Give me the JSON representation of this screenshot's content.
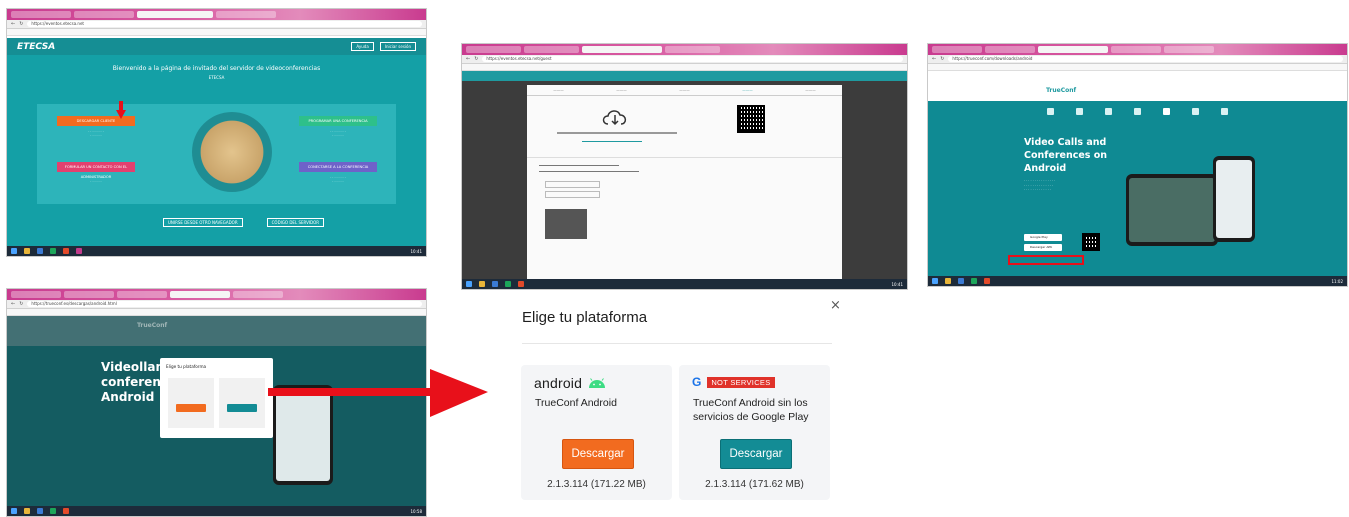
{
  "shot1": {
    "tab_label": "Página de invitado de TrueCon",
    "url": "https://eventos.etecsa.net",
    "logo": "ETECSA",
    "nav_buttons": [
      "Ayuda",
      "Iniciar sesión"
    ],
    "title": "Bienvenido a la página de invitado del servidor de videoconferencias",
    "subtitle": "ETECSA",
    "cards": [
      "DESCARGAR CLIENTE",
      "PROGRAMAR UNA CONFERENCIA",
      "FORMULAR UN CONTACTO CON EL ADMINISTRADOR",
      "CONECTARSE A LA CONFERENCIA"
    ],
    "bottom_buttons": [
      "UNIRSE DESDE OTRO NAVEGADOR",
      "CÓDIGO DEL SERVIDOR"
    ],
    "clock": "10:41"
  },
  "shot2": {
    "tab_label": "Página de invitado de TrueConf",
    "url": "https://eventos.etecsa.net/guest",
    "clock": "10:41"
  },
  "shot3": {
    "tab_label": "Videoconferencias",
    "url": "https://trueconf.com/downloads/android",
    "logo": "TrueConf",
    "hero": [
      "Video Calls and",
      "Conferences on",
      "Android"
    ],
    "store_buttons": [
      "Google Play",
      "Descargar APK"
    ],
    "clock": "11:02"
  },
  "shot4": {
    "url": "https://trueconf.es/descargas/android.html",
    "logo": "TrueConf",
    "hero": [
      "Videollamad",
      "conferencias",
      "Android"
    ],
    "dialog_title": "Elige tu plataforma",
    "clock": "10:58"
  },
  "dialog": {
    "title": "Elige tu plataforma",
    "close": "×",
    "android": {
      "brand": "android",
      "name": "TrueConf Android",
      "button": "Descargar",
      "version": "2.1.3.114 (171.22 MB)"
    },
    "google": {
      "brand": "G",
      "badge": "NOT SERVICES",
      "name": "TrueConf Android sin los servicios de Google Play",
      "button": "Descargar",
      "version": "2.1.3.114 (171.62 MB)"
    }
  },
  "colors": {
    "android_button": "#f26b1f",
    "google_button": "#138c95",
    "badge": "#e0322a",
    "arrow": "#e8101a",
    "etecsa_teal": "#14a0a6"
  }
}
